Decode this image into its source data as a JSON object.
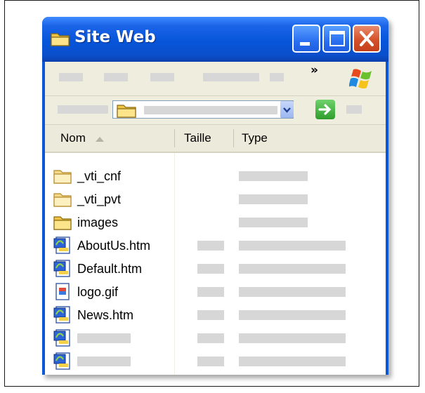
{
  "window": {
    "title": "Site Web"
  },
  "columns": {
    "name": "Nom",
    "size": "Taille",
    "type": "Type"
  },
  "toolbar": {
    "chevron": "»"
  },
  "files": [
    {
      "name": "_vti_cnf",
      "icon": "folder-icon",
      "kind": "folder"
    },
    {
      "name": "_vti_pvt",
      "icon": "folder-icon",
      "kind": "folder"
    },
    {
      "name": "images",
      "icon": "folder-icon",
      "kind": "folder"
    },
    {
      "name": "AboutUs.htm",
      "icon": "htm-file-icon",
      "kind": "file"
    },
    {
      "name": "Default.htm",
      "icon": "htm-file-icon",
      "kind": "file"
    },
    {
      "name": "logo.gif",
      "icon": "gif-file-icon",
      "kind": "file"
    },
    {
      "name": "News.htm",
      "icon": "htm-file-icon",
      "kind": "file"
    },
    {
      "name": "",
      "icon": "htm-file-icon",
      "kind": "file"
    },
    {
      "name": "",
      "icon": "htm-file-icon",
      "kind": "file"
    }
  ],
  "colors": {
    "titlebar": "#0655d9",
    "close": "#d5512a",
    "go": "#2f9d2b",
    "placeholder": "#d7d7d7"
  }
}
